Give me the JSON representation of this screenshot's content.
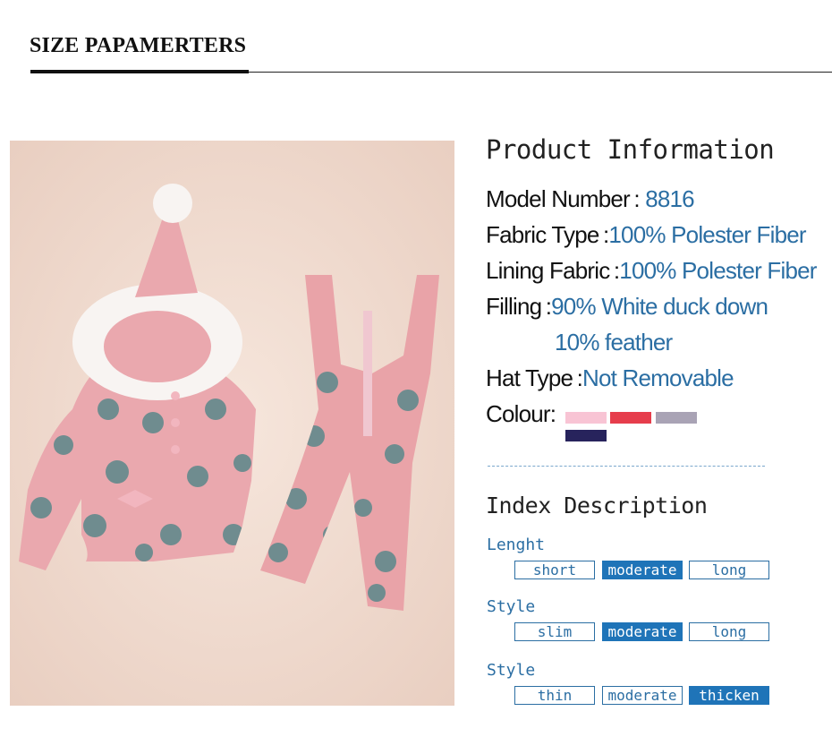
{
  "header": {
    "title": "SIZE PAPAMERTERS"
  },
  "product_info": {
    "title": "Product  Information",
    "rows": [
      {
        "key": "Model Number :",
        "value": "8816"
      },
      {
        "key": "Fabric Type :",
        "value": "100% Polester Fiber"
      },
      {
        "key": "Lining Fabric :",
        "value": "100% Polester Fiber"
      },
      {
        "key": "Filling :",
        "value": "90%  White duck down"
      },
      {
        "key": "",
        "value": "10%   feather"
      },
      {
        "key": "Hat Type :",
        "value": "Not Removable"
      }
    ],
    "colour_label": "Colour:",
    "colours": [
      "#f8c4d4",
      "#e63d4c",
      "#a9a3b5",
      "#27235c"
    ]
  },
  "index": {
    "title": "Index Description",
    "groups": [
      {
        "label": "Lenght",
        "options": [
          "short",
          "moderate",
          "long"
        ],
        "selected": "moderate"
      },
      {
        "label": "Style",
        "options": [
          "slim",
          "moderate",
          "long"
        ],
        "selected": "moderate"
      },
      {
        "label": "Style",
        "options": [
          "thin",
          "moderate",
          "thicken"
        ],
        "selected": "thicken"
      }
    ]
  }
}
